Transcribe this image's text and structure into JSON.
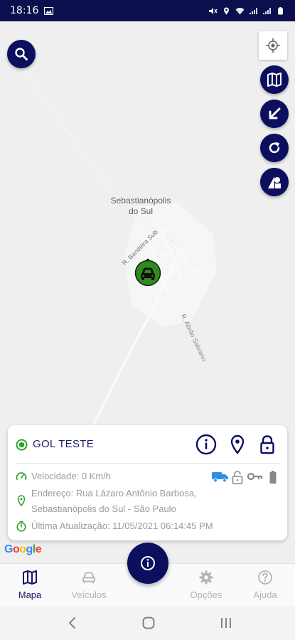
{
  "status_bar": {
    "time": "18:16",
    "icons": [
      "image-icon",
      "mute-icon",
      "location-icon",
      "wifi-icon",
      "signal-icon",
      "signal-icon",
      "battery-icon"
    ]
  },
  "map": {
    "city_label_line1": "Sebastianópolis",
    "city_label_line2": "do Sul",
    "street_a": "R. Bandeira Sub",
    "street_b": "R. Abrão Salviano",
    "attribution": "Google",
    "marker_color": "#2e8b1e",
    "accent_color": "#0c0f5e"
  },
  "card": {
    "vehicle_name": "GOL TESTE",
    "speed": "Velocidade: 0 Km/h",
    "address_line1": "Endereço: Rua Lázaro Antônio Barbosa,",
    "address_line2": "Sebastianópolis do Sul - São Paulo",
    "last_update": "Última Atualização: 11/05/2021 06:14:45 PM",
    "status_icons": [
      "truck-icon",
      "lock-open-icon",
      "key-icon",
      "battery-icon"
    ]
  },
  "bottom_nav": {
    "items": [
      {
        "label": "Mapa",
        "icon": "map-icon",
        "active": true
      },
      {
        "label": "Veículos",
        "icon": "car-icon",
        "active": false
      },
      {
        "label": "Opções",
        "icon": "gear-icon",
        "active": false
      },
      {
        "label": "Ajuda",
        "icon": "help-icon",
        "active": false
      }
    ]
  },
  "colors": {
    "primary": "#0c0f5e",
    "green": "#2fa32f",
    "truck_blue": "#2f8fe8",
    "muted_text": "#9a9a9a"
  }
}
